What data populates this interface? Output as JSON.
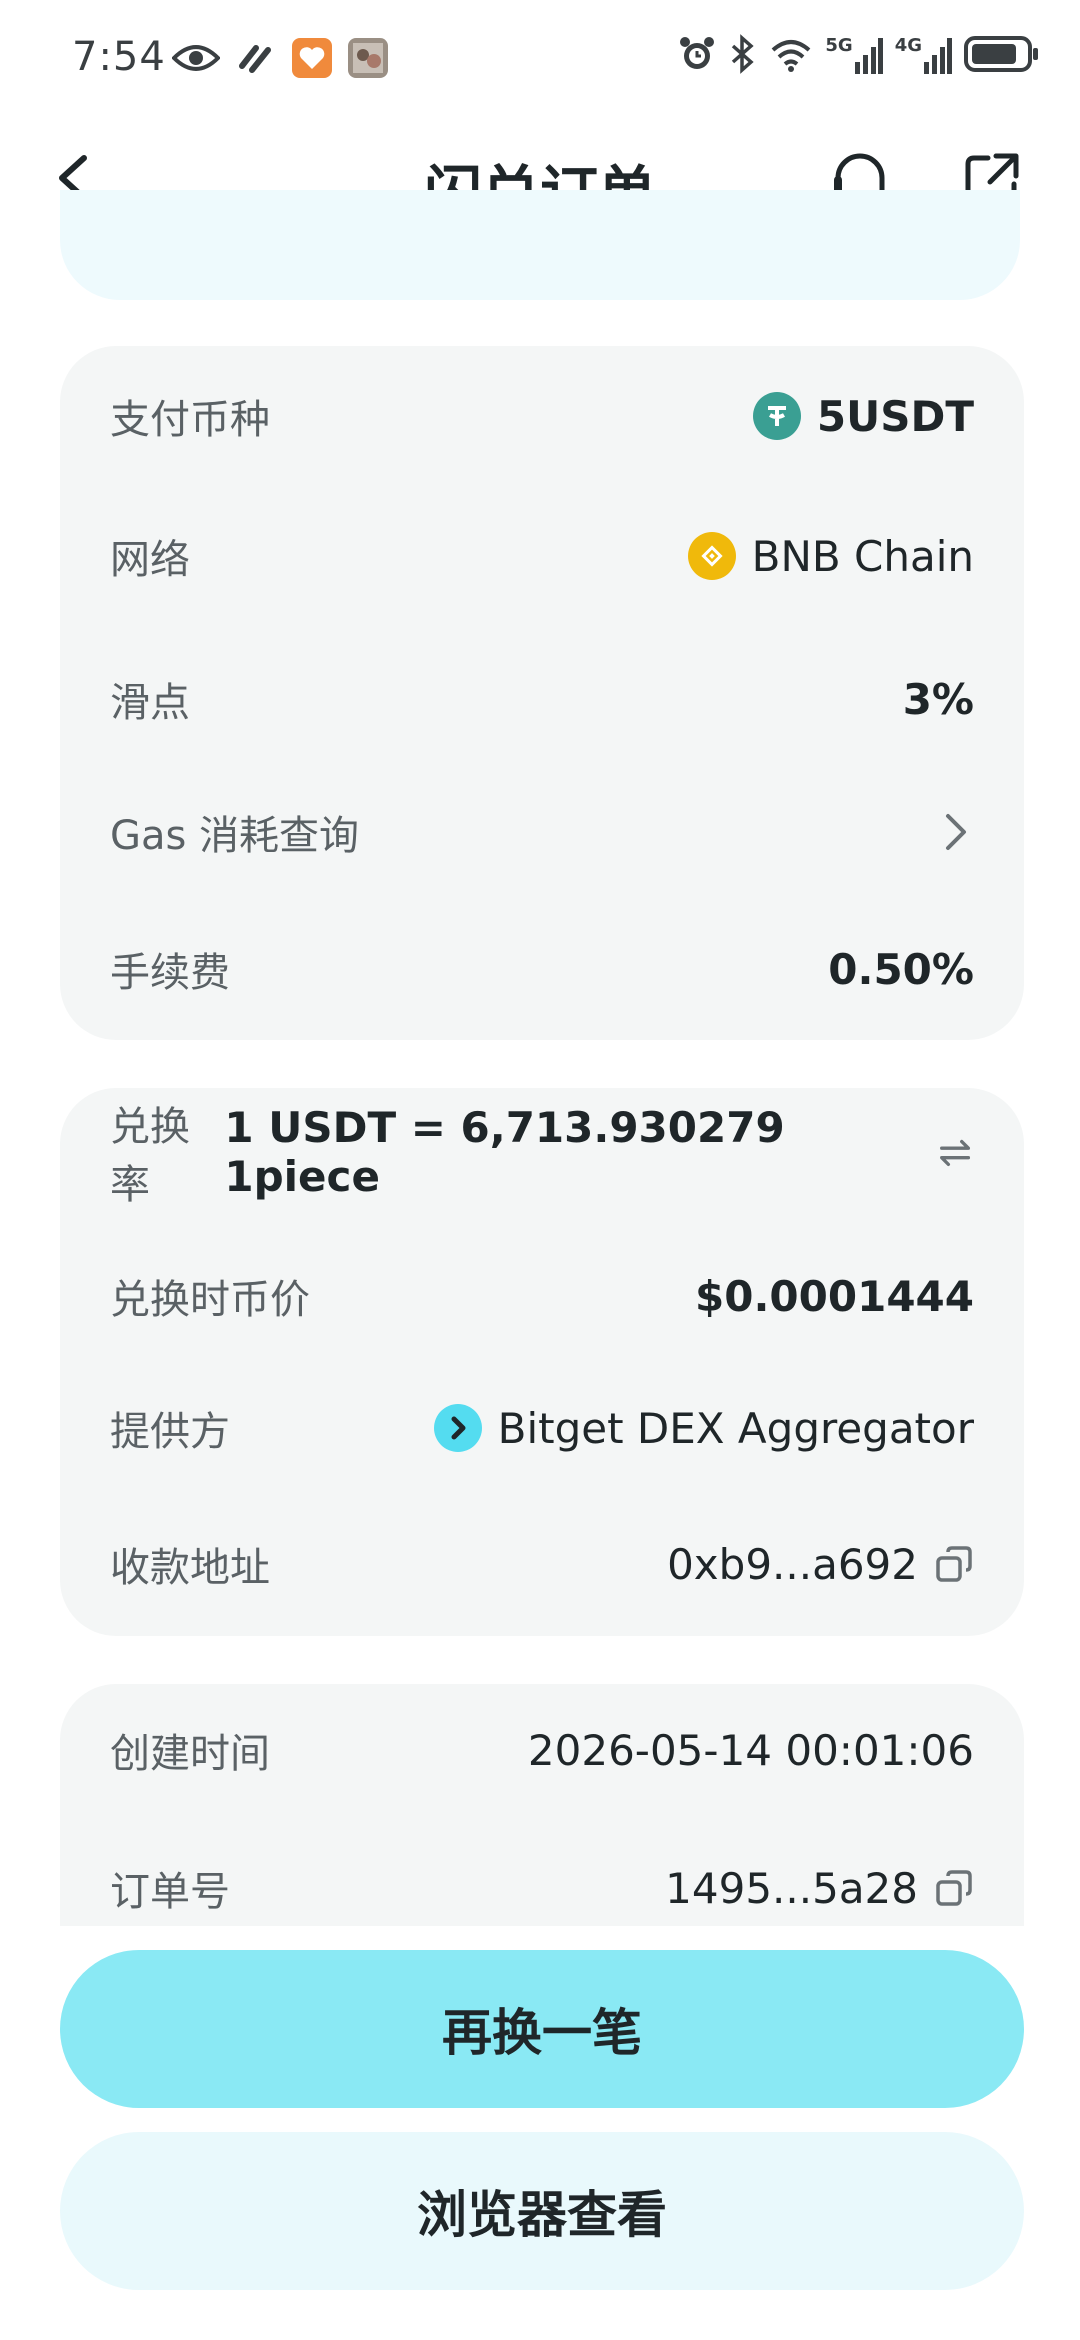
{
  "status_bar": {
    "time": "7:54",
    "network_5g": "5G",
    "network_4g": "4G"
  },
  "header": {
    "title": "闪兑订单"
  },
  "payment_card": {
    "rows": [
      {
        "label": "支付币种",
        "value": "5USDT",
        "icon": "tether-icon"
      },
      {
        "label": "网络",
        "value": "BNB Chain",
        "icon": "bnb-icon"
      },
      {
        "label": "滑点",
        "value": "3%"
      },
      {
        "label": "Gas 消耗查询",
        "value": ""
      },
      {
        "label": "手续费",
        "value": "0.50%"
      }
    ]
  },
  "exchange_card": {
    "rows": [
      {
        "label": "兑换率",
        "value": "1 USDT = 6,713.930279 1piece"
      },
      {
        "label": "兑换时币价",
        "value": "$0.0001444"
      },
      {
        "label": "提供方",
        "value": "Bitget DEX Aggregator"
      },
      {
        "label": "收款地址",
        "value": "0xb9...a692"
      }
    ]
  },
  "order_card": {
    "rows": [
      {
        "label": "创建时间",
        "value": "2026-05-14 00:01:06"
      },
      {
        "label": "订单号",
        "value": "1495...5a28"
      }
    ]
  },
  "actions": {
    "primary": "再换一笔",
    "secondary": "浏览器查看"
  },
  "colors": {
    "primary_button": "#8ae9f4",
    "secondary_button": "#e9f9fc",
    "card_bg": "#f4f6f6",
    "tether": "#3a9f93",
    "bnb": "#f0b90b",
    "bitget": "#54dcf0"
  }
}
